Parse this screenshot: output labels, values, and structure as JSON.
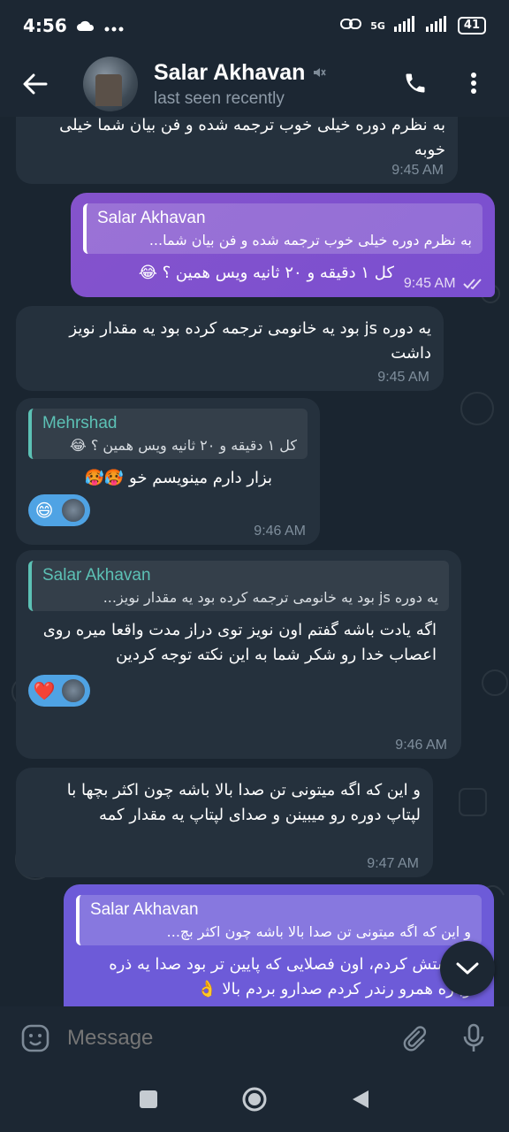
{
  "status_bar": {
    "time": "4:56",
    "network": "5G",
    "battery": "41"
  },
  "header": {
    "name": "Salar Akhavan",
    "status": "last seen recently"
  },
  "messages": [
    {
      "id": "m1",
      "dir": "in",
      "text": "به نظرم دوره خیلی خوب ترجمه شده و فن بیان شما خیلی خوبه",
      "time": "9:45 AM"
    },
    {
      "id": "m2",
      "dir": "out",
      "reply_name": "Salar Akhavan",
      "reply_text": "به نظرم دوره خیلی خوب ترجمه شده و فن بیان شما...",
      "text": "کل ۱ دقیقه و ۲۰ ثانیه ویس همین ؟ 😂",
      "time": "9:45 AM"
    },
    {
      "id": "m3",
      "dir": "in",
      "text": "یه دوره js بود یه خانومی ترجمه کرده بود یه مقدار نویز داشت",
      "time": "9:45 AM"
    },
    {
      "id": "m4",
      "dir": "in",
      "reply_name": "Mehrshad",
      "reply_text": "کل ۱ دقیقه و ۲۰ ثانیه ویس همین ؟ 😂",
      "text": "بزار دارم مینویسم خو 🥵🥵",
      "reaction": "😄",
      "time": "9:46 AM"
    },
    {
      "id": "m5",
      "dir": "in",
      "reply_name": "Salar Akhavan",
      "reply_text": "یه دوره js بود یه خانومی ترجمه کرده بود یه مقدار نویز...",
      "text": "اگه یادت باشه گفتم اون نویز توی دراز مدت واقعا میره روی اعصاب خدا رو شکر شما به این نکته توجه کردین",
      "reaction": "❤️",
      "time": "9:46 AM"
    },
    {
      "id": "m6",
      "dir": "in",
      "text": "و این که اگه میتونی تن صدا بالا باشه چون اکثر بچها با لپتاپ دوره رو میبینن و صدای لپتاپ یه مقدار کمه",
      "time": "9:47 AM"
    },
    {
      "id": "m7",
      "dir": "out2",
      "reply_name": "Salar Akhavan",
      "reply_text": "و این که اگه میتونی تن صدا بالا باشه چون اکثر بچ...",
      "text": "و درستش کردم، اون فصلایی که پایین تر بود صدا یه ذره دوباره همرو رندر کردم صدارو بردم بالا 👌"
    }
  ],
  "input": {
    "placeholder": "Message"
  },
  "colors": {
    "header_bg": "#1c2733",
    "incoming": "#25313d",
    "outgoing": "#8553cc",
    "accent": "#5cc1b5",
    "reaction": "#4fa3e4"
  },
  "icons": [
    "back-arrow-icon",
    "mute-icon",
    "phone-icon",
    "more-vert-icon",
    "emoji-icon",
    "attach-icon",
    "mic-icon",
    "chevron-down-icon"
  ]
}
